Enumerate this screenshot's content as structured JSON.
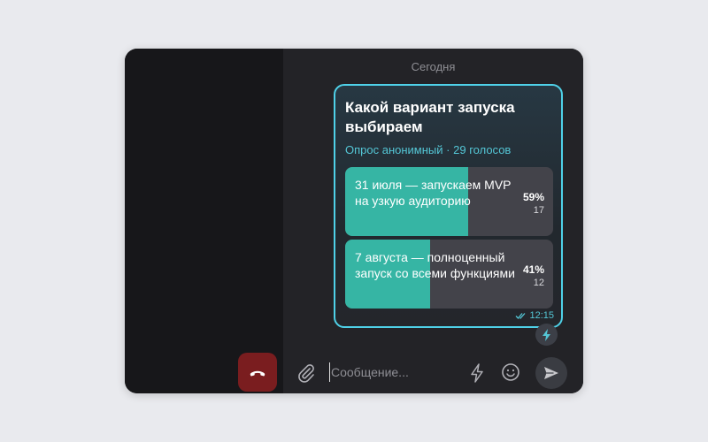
{
  "chat": {
    "date_separator": "Сегодня"
  },
  "poll": {
    "question": "Какой вариант запуска выбираем",
    "meta_type": "Опрос анонимный",
    "meta_dot": "·",
    "meta_votes": "29 голосов",
    "options": [
      {
        "label": "31 июля — запускаем MVP на узкую аудиторию",
        "percent_text": "59%",
        "count_text": "17",
        "fraction": 0.59
      },
      {
        "label": "7 августа — полноценный запуск со всеми функциями",
        "percent_text": "41%",
        "count_text": "12",
        "fraction": 0.41
      }
    ],
    "time": "12:15"
  },
  "composer": {
    "placeholder": "Сообщение..."
  },
  "colors": {
    "accent": "#4fd1e8",
    "fill": "#36b5a4",
    "end_call": "#7a1d1f"
  },
  "icons": [
    "end-call-icon",
    "double-check-icon",
    "bolt-icon",
    "paperclip-icon",
    "smile-icon",
    "send-icon"
  ]
}
